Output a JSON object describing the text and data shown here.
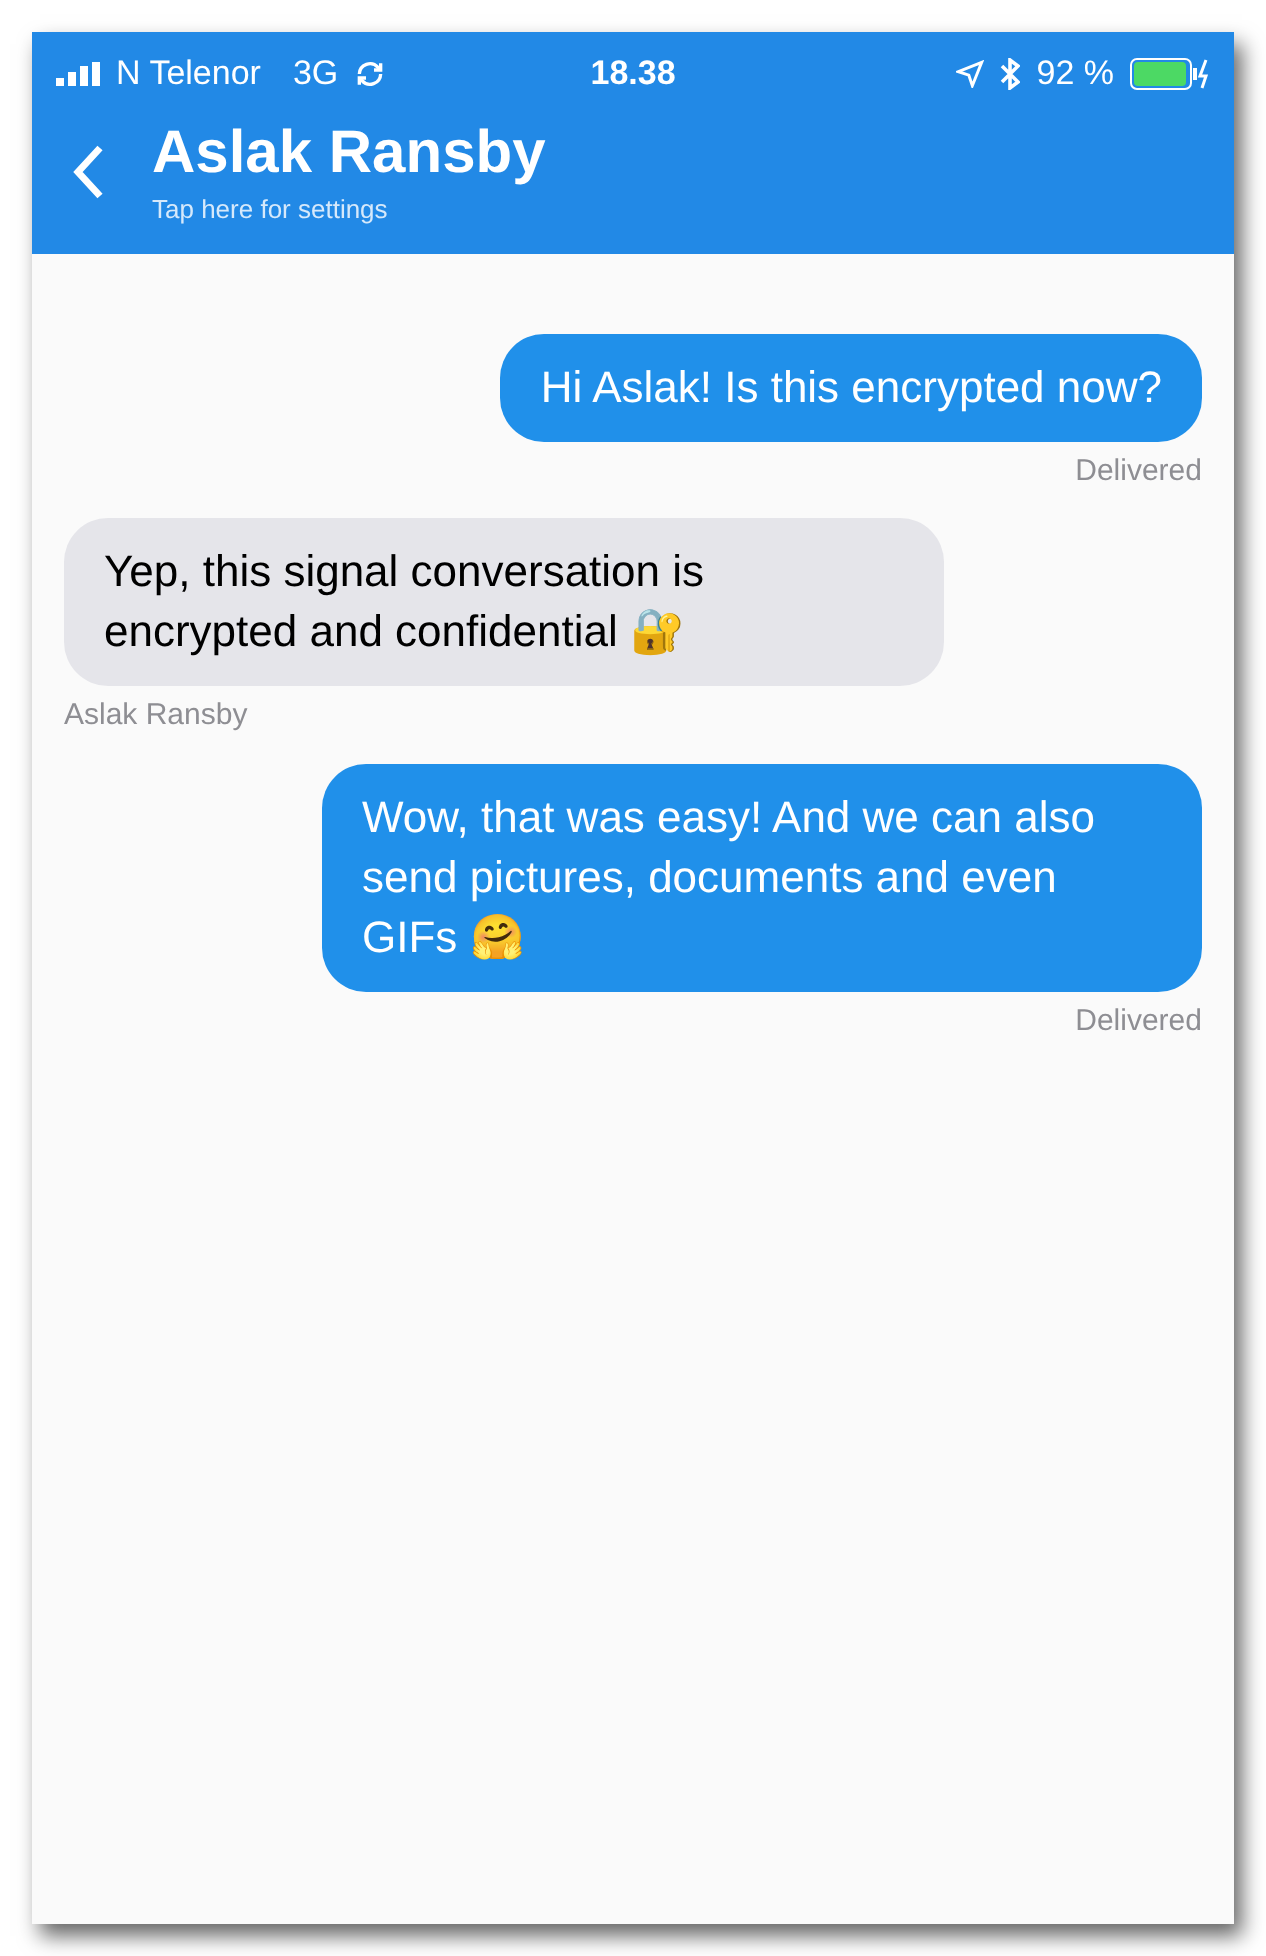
{
  "status_bar": {
    "carrier": "N Telenor",
    "network": "3G",
    "time": "18.38",
    "battery": "92 %"
  },
  "header": {
    "title": "Aslak Ransby",
    "subtitle": "Tap here for settings"
  },
  "messages": [
    {
      "kind": "outgoing",
      "text": "Hi Aslak! Is this encrypted now?",
      "status": "Delivered"
    },
    {
      "kind": "incoming",
      "text": "Yep, this signal conversation is encrypted and confidential 🔐",
      "sender": "Aslak Ransby"
    },
    {
      "kind": "outgoing",
      "text": "Wow, that was easy! And we can also send pictures, documents and even GIFs 🤗",
      "status": "Delivered"
    }
  ]
}
